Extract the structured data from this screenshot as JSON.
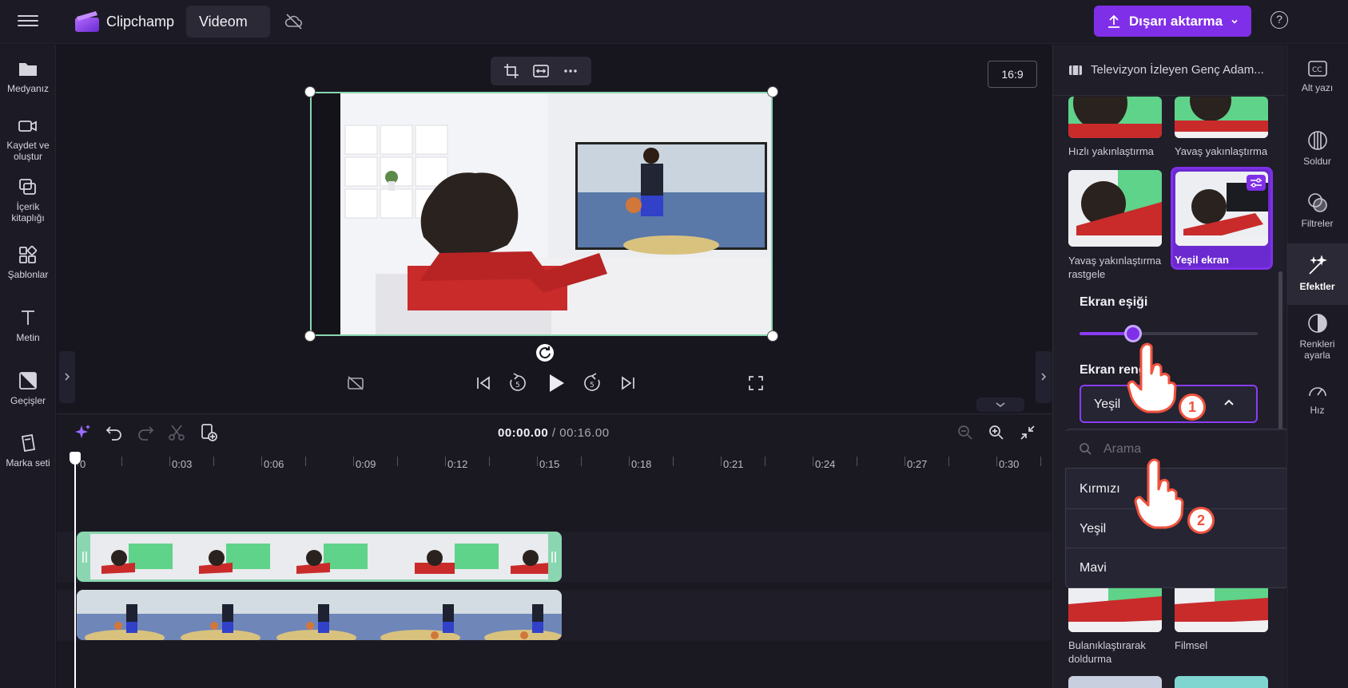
{
  "app": {
    "brand": "Clipchamp",
    "project_name": "Videom",
    "export_label": "Dışarı aktarma",
    "help_glyph": "?"
  },
  "left_sidebar": [
    {
      "label": "Medyanız",
      "icon": "folder-icon"
    },
    {
      "label": "Kaydet ve oluştur",
      "icon": "camera-icon"
    },
    {
      "label": "İçerik kitaplığı",
      "icon": "content-library-icon"
    },
    {
      "label": "Şablonlar",
      "icon": "templates-icon"
    },
    {
      "label": "Metin",
      "icon": "text-icon"
    },
    {
      "label": "Geçişler",
      "icon": "transitions-icon"
    },
    {
      "label": "Marka seti",
      "icon": "brand-kit-icon"
    }
  ],
  "preview": {
    "aspect_ratio": "16:9"
  },
  "timeline": {
    "current_time": "00:00.00",
    "total_time": "/ 00:16.00",
    "ruler_labels": [
      "0",
      "0:03",
      "0:06",
      "0:09",
      "0:12",
      "0:15",
      "0:18",
      "0:21",
      "0:24",
      "0:27",
      "0:30"
    ]
  },
  "right_panel": {
    "clip_title": "Televizyon İzleyen Genç Adam...",
    "effects": [
      {
        "label": "Hızlı yakınlaştırma"
      },
      {
        "label": "Yavaş yakınlaştırma"
      },
      {
        "label": "Yavaş yakınlaştırma rastgele"
      },
      {
        "label": "Yeşil ekran",
        "selected": true
      },
      {
        "label": "Bulanıklaştırarak doldurma"
      },
      {
        "label": "Filmsel"
      }
    ],
    "threshold_label": "Ekran eşiği",
    "threshold_value": 0.3,
    "color_label": "Ekran reng",
    "color_selected": "Yeşil",
    "dropdown": {
      "search_placeholder": "Arama",
      "options": [
        "Kırmızı",
        "Yeşil",
        "Mavi"
      ]
    }
  },
  "right_rail": [
    {
      "label": "Alt yazı",
      "icon": "captions-icon"
    },
    {
      "label": "Soldur",
      "icon": "fade-icon"
    },
    {
      "label": "Filtreler",
      "icon": "filters-icon"
    },
    {
      "label": "Efektler",
      "icon": "effects-icon",
      "active": true
    },
    {
      "label": "Renkleri ayarla",
      "icon": "adjust-colors-icon"
    },
    {
      "label": "Hız",
      "icon": "speed-icon"
    }
  ],
  "annotations": {
    "step1": "1",
    "step2": "2"
  },
  "colors": {
    "accent": "#7f2fe8",
    "clip_border": "#8ad6b0",
    "annotation": "#f0523d"
  }
}
